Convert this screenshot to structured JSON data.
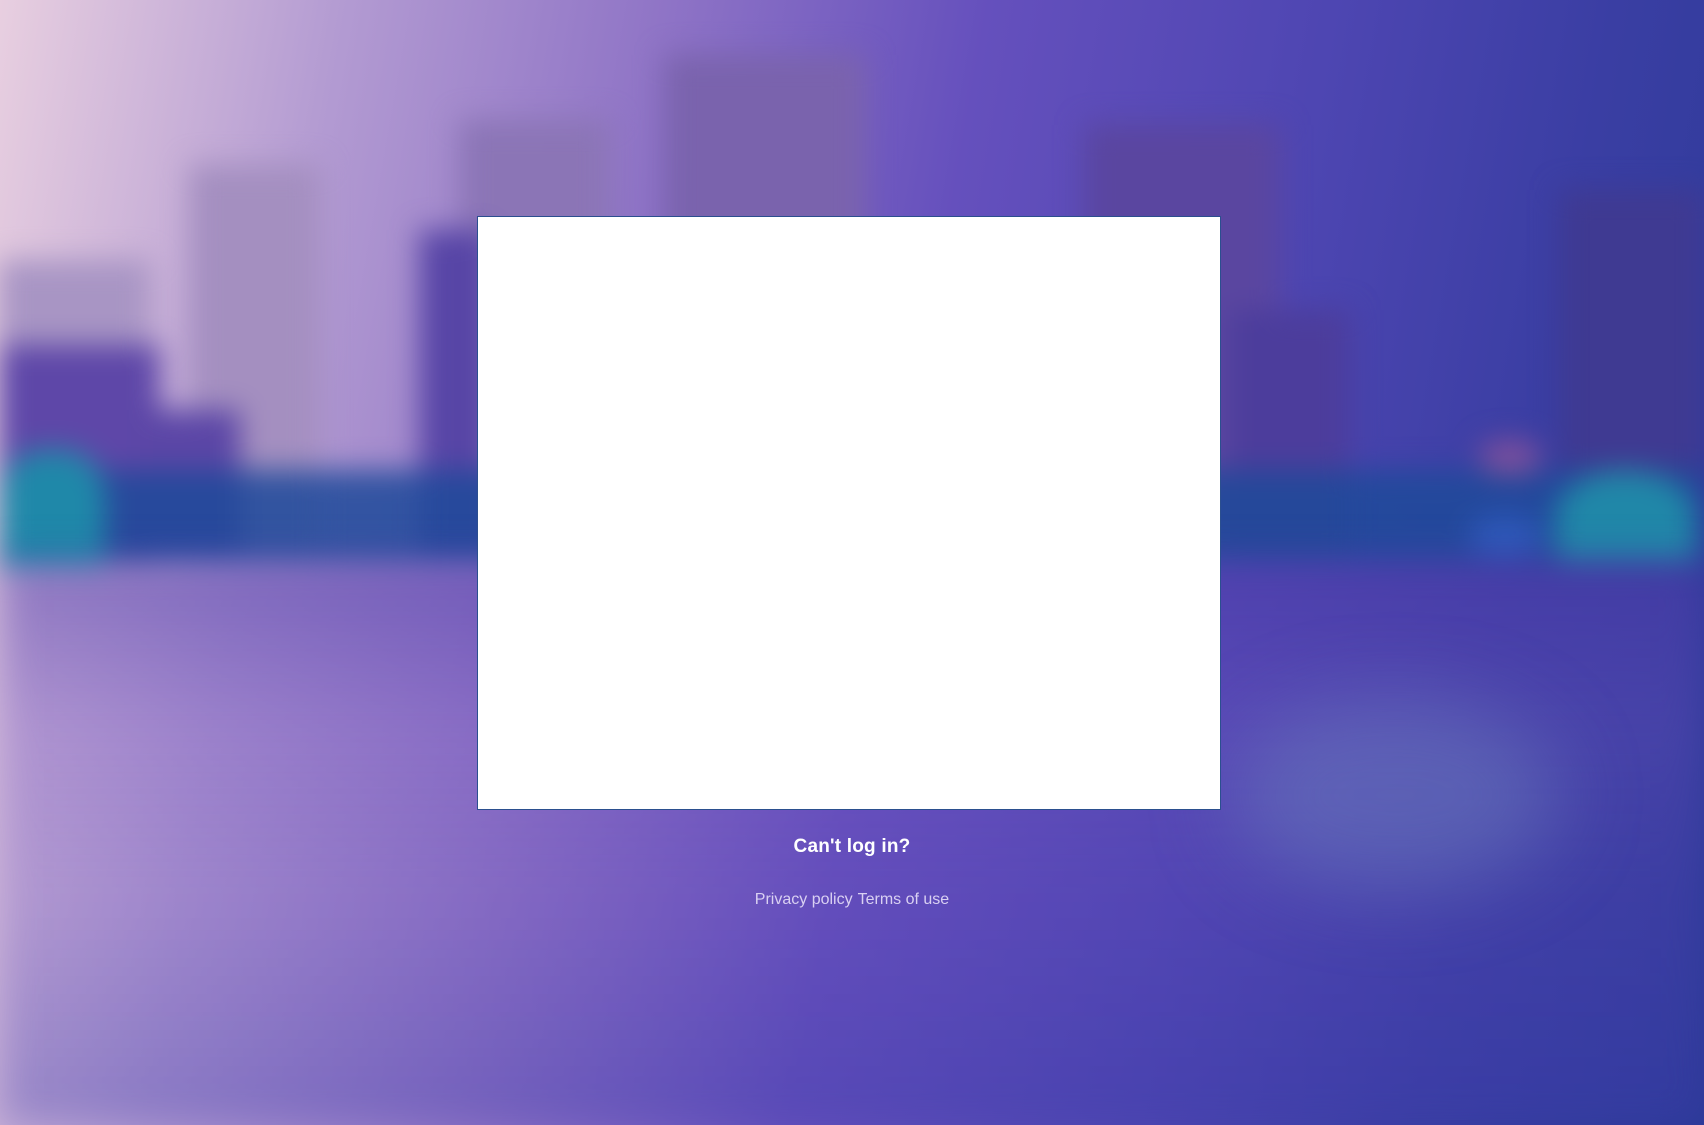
{
  "login": {
    "cant_login_label": "Can't log in?"
  },
  "footer": {
    "privacy_label": "Privacy policy",
    "terms_label": "Terms of use"
  },
  "colors": {
    "background_start": "#e8cfe0",
    "background_mid": "#6550bd",
    "background_end": "#2c3a98",
    "card_background": "#ffffff",
    "card_border": "#2b4f8f",
    "link_text": "#ffffff",
    "footer_text": "#d9d0f2"
  }
}
